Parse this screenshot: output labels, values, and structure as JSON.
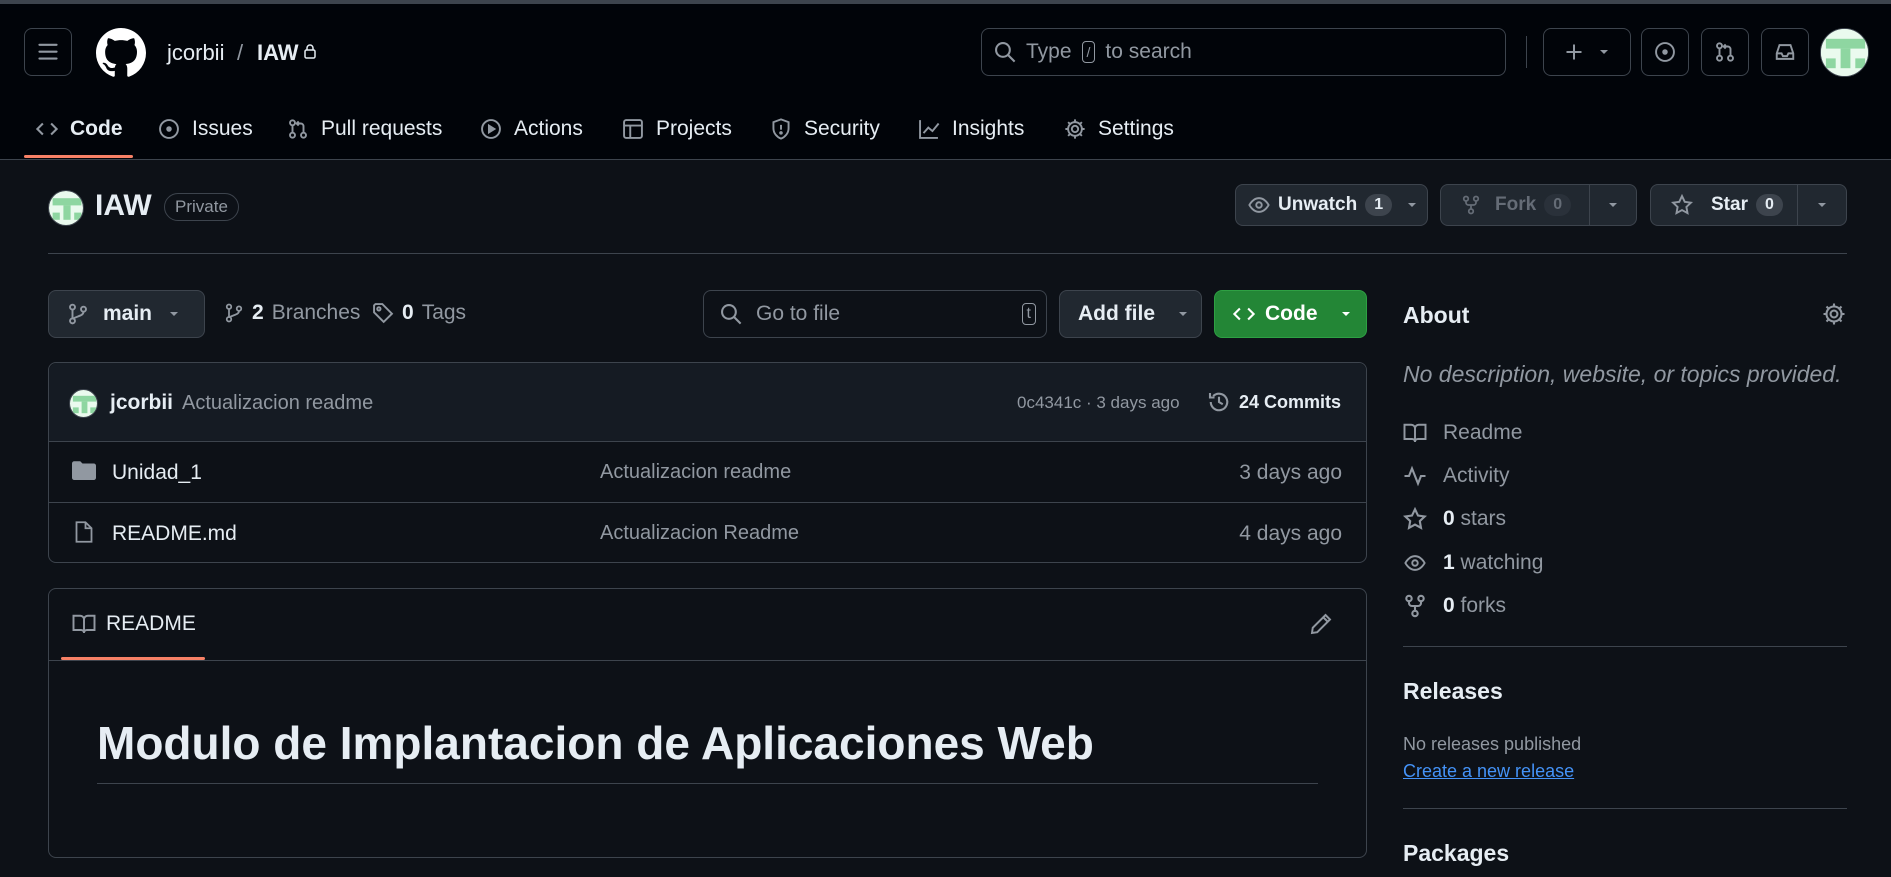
{
  "header": {
    "owner": "jcorbii",
    "separator": "/",
    "repo": "IAW",
    "search_prefix": "Type",
    "search_key": "/",
    "search_suffix": "to search"
  },
  "tabs": [
    {
      "label": "Code",
      "icon": "code-icon"
    },
    {
      "label": "Issues",
      "icon": "issue-icon"
    },
    {
      "label": "Pull requests",
      "icon": "pull-request-icon"
    },
    {
      "label": "Actions",
      "icon": "play-icon"
    },
    {
      "label": "Projects",
      "icon": "table-icon"
    },
    {
      "label": "Security",
      "icon": "shield-icon"
    },
    {
      "label": "Insights",
      "icon": "graph-icon"
    },
    {
      "label": "Settings",
      "icon": "gear-icon"
    }
  ],
  "repo_header": {
    "name": "IAW",
    "visibility": "Private",
    "unwatch_label": "Unwatch",
    "unwatch_count": "1",
    "fork_label": "Fork",
    "fork_count": "0",
    "star_label": "Star",
    "star_count": "0"
  },
  "toolbar": {
    "branch": "main",
    "branches_count": "2",
    "branches_label": "Branches",
    "tags_count": "0",
    "tags_label": "Tags",
    "goto_placeholder": "Go to file",
    "goto_key": "t",
    "add_file_label": "Add file",
    "code_label": "Code"
  },
  "commit": {
    "author": "jcorbii",
    "message": "Actualizacion readme",
    "meta": "0c4341c · 3 days ago",
    "commits_label": "24 Commits"
  },
  "files": [
    {
      "name": "Unidad_1",
      "type": "folder",
      "message": "Actualizacion readme",
      "age": "3 days ago"
    },
    {
      "name": "README.md",
      "type": "file",
      "message": "Actualizacion Readme",
      "age": "4 days ago"
    }
  ],
  "readme": {
    "tab_label": "README",
    "heading": "Modulo de Implantacion de Aplicaciones Web"
  },
  "about": {
    "title": "About",
    "description": "No description, website, or topics provided.",
    "items": [
      {
        "icon": "book-icon",
        "count": "",
        "label": "Readme"
      },
      {
        "icon": "pulse-icon",
        "count": "",
        "label": "Activity"
      },
      {
        "icon": "star-icon",
        "count": "0",
        "label": "stars"
      },
      {
        "icon": "eye-icon",
        "count": "1",
        "label": "watching"
      },
      {
        "icon": "fork-icon",
        "count": "0",
        "label": "forks"
      }
    ]
  },
  "releases": {
    "title": "Releases",
    "empty_text": "No releases published",
    "create_link": "Create a new release"
  },
  "packages": {
    "title": "Packages"
  },
  "colors": {
    "accent_green": "#238636",
    "tab_underline": "#f78166",
    "link": "#4493f8"
  }
}
